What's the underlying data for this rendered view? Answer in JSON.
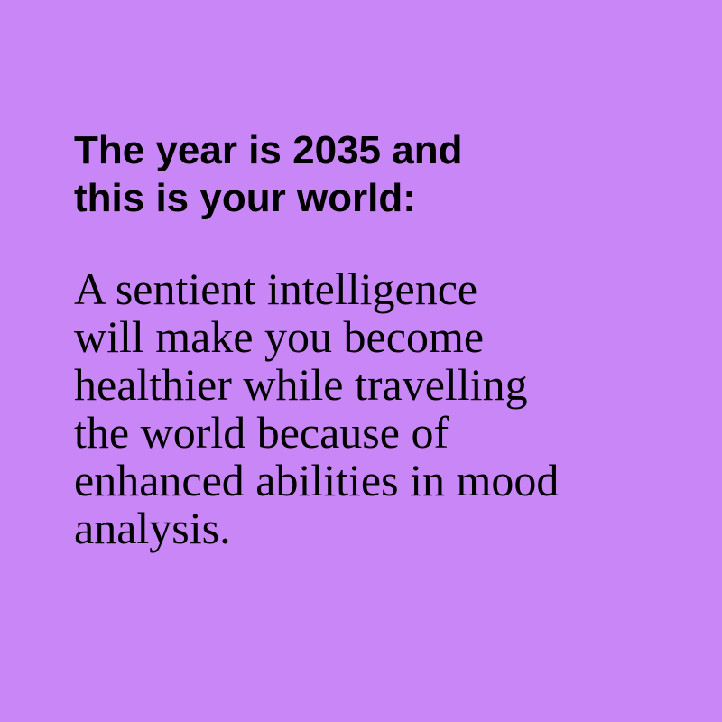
{
  "colors": {
    "background": "#C986F7",
    "text": "#000000"
  },
  "headline": {
    "lines": [
      "The year is 2035 and",
      "this is your world:"
    ]
  },
  "body": {
    "lines": [
      "A sentient intelligence",
      "will make you become",
      "healthier while travelling",
      "the world because of",
      "enhanced abilities in mood",
      "analysis."
    ]
  }
}
